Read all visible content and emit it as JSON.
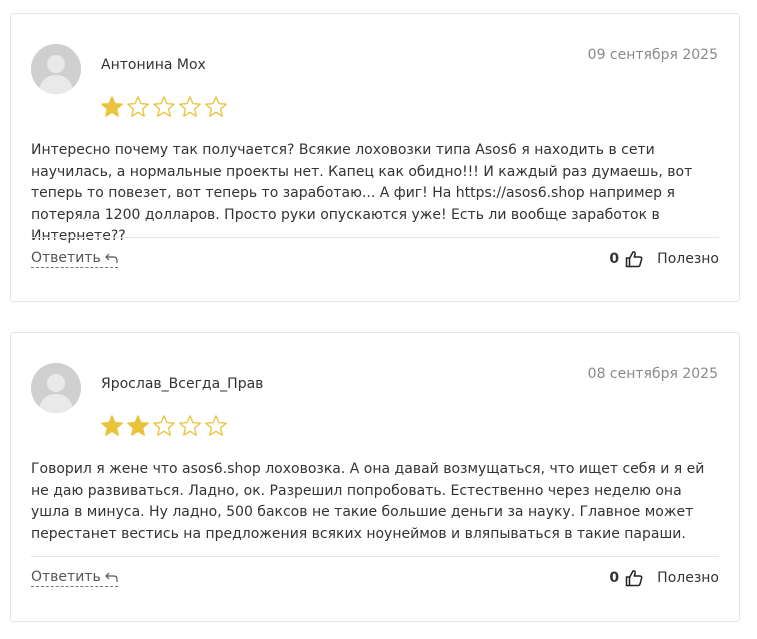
{
  "colors": {
    "star_filled": "#E8C33B",
    "star_empty_stroke": "#E8C33B",
    "border": "#E6E6E6",
    "date": "#8A8A8A"
  },
  "reviews": [
    {
      "author": "Антонина Мох",
      "date": "09 сентября 2025",
      "rating": 1,
      "max_rating": 5,
      "text": "Интересно почему так получается? Всякие лоховозки типа Asos6 я находить в сети научилась, а нормальные проекты нет. Капец как обидно!!! И каждый раз думаешь, вот теперь то повезет, вот теперь то заработаю... А фиг! На https://asos6.shop например я потеряла 1200 долларов. Просто руки опускаются уже! Есть ли вообще заработок в Интернете??",
      "reply_label": "Ответить",
      "likes": "0",
      "useful_label": "Полезно"
    },
    {
      "author": "Ярослав_Всегда_Прав",
      "date": "08 сентября 2025",
      "rating": 2,
      "max_rating": 5,
      "text": "Говорил я жене что asos6.shop лоховозка. А она давай возмущаться, что ищет себя и я ей не даю развиваться. Ладно, ок. Разрешил попробовать. Естественно через неделю она ушла в минуса. Ну ладно, 500 баксов не такие большие деньги за науку. Главное может перестанет вестись на предложения всяких ноунеймов и вляпываться в такие параши.",
      "reply_label": "Ответить",
      "likes": "0",
      "useful_label": "Полезно"
    }
  ]
}
